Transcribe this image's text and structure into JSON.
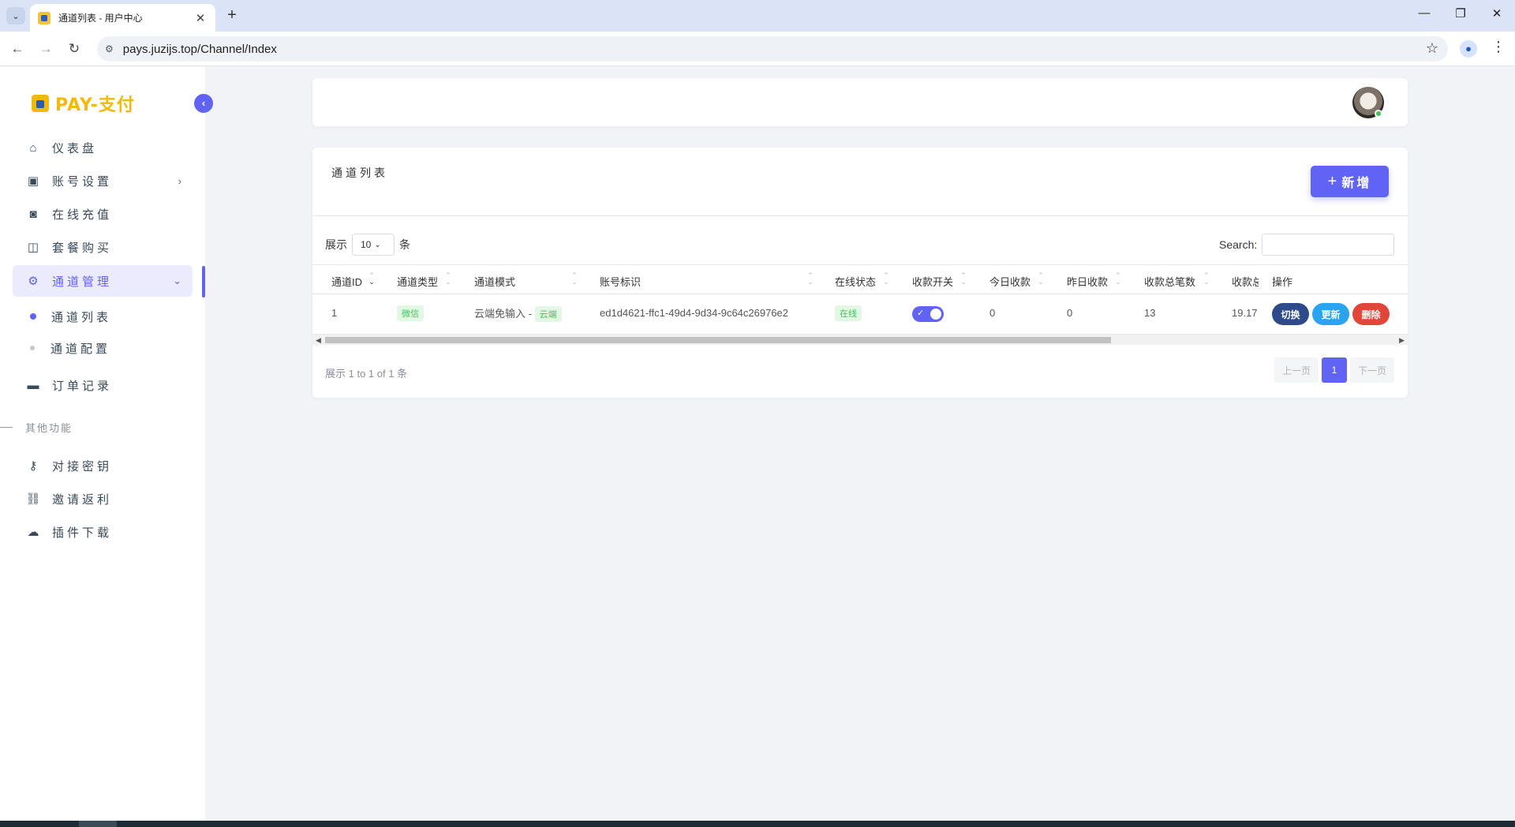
{
  "browser": {
    "tab_title": "通道列表 - 用户中心",
    "url": "pays.juzijs.top/Channel/Index"
  },
  "sidebar": {
    "logo_text": "PAY-支付",
    "items": [
      {
        "label": "仪表盘",
        "icon": "home-icon"
      },
      {
        "label": "账号设置",
        "icon": "account-icon"
      },
      {
        "label": "在线充值",
        "icon": "camera-icon"
      },
      {
        "label": "套餐购买",
        "icon": "shopping-bag-icon"
      },
      {
        "label": "通道管理",
        "icon": "gear-icon"
      },
      {
        "label": "订单记录",
        "icon": "wallet-icon"
      }
    ],
    "sub_items": [
      {
        "label": "通道列表"
      },
      {
        "label": "通道配置"
      }
    ],
    "section_title": "其他功能",
    "other_items": [
      {
        "label": "对接密钥",
        "icon": "key-icon"
      },
      {
        "label": "邀请返利",
        "icon": "link-icon"
      },
      {
        "label": "插件下载",
        "icon": "cloud-download-icon"
      }
    ]
  },
  "card": {
    "title": "通道列表",
    "add_label": "新增",
    "length_prefix": "展示",
    "length_value": "10",
    "length_suffix": "条",
    "search_label": "Search:",
    "search_value": "",
    "columns": [
      "通道ID",
      "通道类型",
      "通道模式",
      "账号标识",
      "在线状态",
      "收款开关",
      "今日收款",
      "昨日收款",
      "收款总笔数",
      "收款总",
      "操作"
    ],
    "rows": [
      {
        "id": "1",
        "type": "微信",
        "mode": "云端免输入 -",
        "mode_badge": "云端",
        "account": "ed1d4621-ffc1-49d4-9d34-9c64c26976e2",
        "status": "在线",
        "switch_on": true,
        "today": "0",
        "yesterday": "0",
        "total_count": "13",
        "total_amount": "19.17",
        "actions": [
          "切换",
          "更新",
          "删除"
        ]
      }
    ],
    "info": "展示 1 to 1 of 1 条",
    "pager": {
      "prev": "上一页",
      "current": "1",
      "next": "下一页"
    }
  },
  "colors": {
    "accent": "#6063f3",
    "switch_btn": "#2f4a8a",
    "update_btn": "#2aa3f0",
    "delete_btn": "#e0473a",
    "badge_green": "#4bbd5b"
  }
}
